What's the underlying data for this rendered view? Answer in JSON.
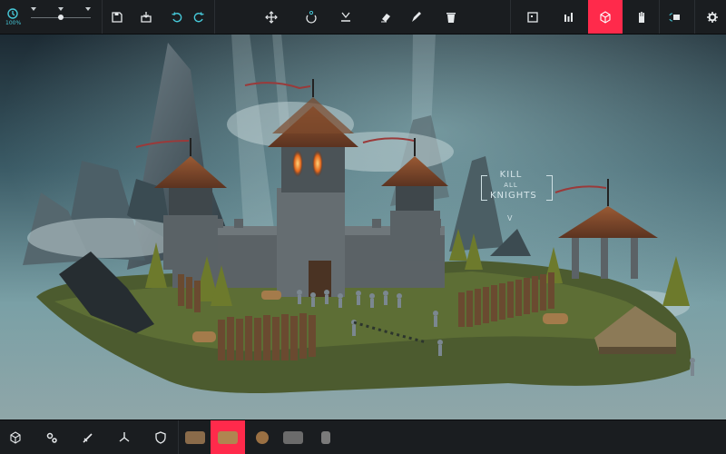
{
  "speed": {
    "label": "100%",
    "level": 0.5
  },
  "top_toolbar": {
    "tools": [
      {
        "name": "move-tool",
        "icon": "move-arrows-icon"
      },
      {
        "name": "rotate-tool",
        "icon": "rotate-icon"
      },
      {
        "name": "drop-tool",
        "icon": "drop-to-ground-icon"
      },
      {
        "name": "paint-tool",
        "icon": "eraser-icon"
      },
      {
        "name": "edit-tool",
        "icon": "pen-icon"
      },
      {
        "name": "delete-tool",
        "icon": "trash-icon"
      }
    ],
    "views": [
      {
        "name": "map-view",
        "icon": "map-frame-icon"
      },
      {
        "name": "stats-view",
        "icon": "bar-chart-icon"
      },
      {
        "name": "units-view",
        "icon": "cube-icon",
        "active": true
      },
      {
        "name": "hand-view",
        "icon": "hand-icon"
      }
    ]
  },
  "bottom_toolbar": {
    "categories": [
      {
        "name": "blocks",
        "icon": "cube-icon"
      },
      {
        "name": "mechanical",
        "icon": "gears-icon"
      },
      {
        "name": "weaponry",
        "icon": "sword-icon"
      },
      {
        "name": "flight",
        "icon": "propeller-icon"
      },
      {
        "name": "armour",
        "icon": "shield-icon"
      }
    ],
    "items": [
      {
        "name": "cannon",
        "color": "#8a6b4a"
      },
      {
        "name": "log",
        "color": "#b08550",
        "active": true
      },
      {
        "name": "wheel",
        "color": "#9a7043"
      },
      {
        "name": "boulder",
        "color": "#6b6b6b"
      },
      {
        "name": "spring",
        "color": "#7a7a7a"
      }
    ]
  },
  "scene": {
    "sign": {
      "line1": "KILL",
      "line2": "ALL",
      "line3": "KNIGHTS",
      "arrow": "V"
    }
  },
  "colors": {
    "accent": "#ff2a4b",
    "toolbar": "#1a1d20",
    "sky": "#4f7c86",
    "ground": "#4c5b2f"
  }
}
